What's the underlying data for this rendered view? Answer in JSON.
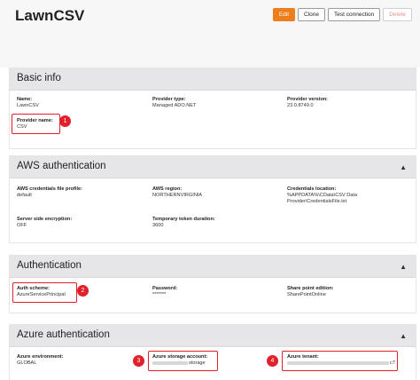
{
  "app": {
    "title": "LawnCSV"
  },
  "toolbar": {
    "edit": "Edit",
    "clone": "Clone",
    "test_connection": "Test connection",
    "delete": "Delete"
  },
  "basic_info": {
    "title": "Basic info",
    "name_label": "Name:",
    "name_value": "LawnCSV",
    "provider_type_label": "Provider type:",
    "provider_type_value": "Managed ADO.NET",
    "provider_version_label": "Provider version:",
    "provider_version_value": "23.0.8749.0",
    "provider_name_label": "Provider name:",
    "provider_name_value": "CSV"
  },
  "aws": {
    "title": "AWS authentication",
    "profile_label": "AWS credentials file profile:",
    "profile_value": "default",
    "region_label": "AWS region:",
    "region_value": "NORTHERNVIRGINIA",
    "cred_loc_label": "Credentials location:",
    "cred_loc_value_1": "%APPDATA%\\CData\\CSV Data",
    "cred_loc_value_2": "Provider\\CredentialsFile.txt",
    "sse_label": "Server side encryption:",
    "sse_value": "OFF",
    "token_label": "Temporary token duration:",
    "token_value": "3600"
  },
  "authentication": {
    "title": "Authentication",
    "scheme_label": "Auth scheme:",
    "scheme_value": "AzureServicePrincipal",
    "password_label": "Password:",
    "password_value": "*******",
    "sp_label": "Share point edition:",
    "sp_value": "SharePointOnline"
  },
  "azure": {
    "title": "Azure authentication",
    "env_label": "Azure environment:",
    "env_value": "GLOBAL",
    "storage_label": "Azure storage account:",
    "storage_value": "storage",
    "tenant_label": "Azure tenant:",
    "tenant_value": "c7"
  },
  "badges": [
    "1",
    "2",
    "3",
    "4"
  ],
  "icons": {
    "collapse": "chevron-up-icon"
  },
  "colors": {
    "accent": "#ee7d1c",
    "highlight": "#e0202a",
    "section_header": "#e6e6e8"
  }
}
